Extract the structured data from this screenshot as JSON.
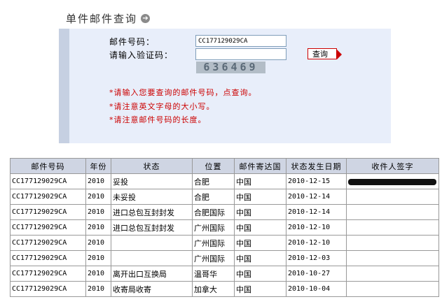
{
  "header": {
    "title": "单件邮件查询"
  },
  "form": {
    "mail_number_label": "邮件号码：",
    "mail_number_value": "CC177129029CA",
    "captcha_label": "请输入验证码：",
    "captcha_value": "",
    "captcha_text": "636469",
    "query_label": "查询"
  },
  "notes": [
    "*请输入您要查询的邮件号码，点查询。",
    "*请注意英文字母的大小写。",
    "*请注意邮件号码的长度。"
  ],
  "table": {
    "headers": [
      "邮件号码",
      "年份",
      "状态",
      "位置",
      "邮件寄达国",
      "状态发生日期",
      "收件人签字"
    ],
    "rows": [
      [
        "CC177129029CA",
        "2010",
        "妥投",
        "合肥",
        "中国",
        "2010-12-15",
        ""
      ],
      [
        "CC177129029CA",
        "2010",
        "未妥投",
        "合肥",
        "中国",
        "2010-12-14",
        ""
      ],
      [
        "CC177129029CA",
        "2010",
        "进口总包互封封发",
        "合肥国际",
        "中国",
        "2010-12-14",
        ""
      ],
      [
        "CC177129029CA",
        "2010",
        "进口总包互封封发",
        "广州国际",
        "中国",
        "2010-12-10",
        ""
      ],
      [
        "CC177129029CA",
        "2010",
        "",
        "广州国际",
        "中国",
        "2010-12-10",
        ""
      ],
      [
        "CC177129029CA",
        "2010",
        "",
        "广州国际",
        "中国",
        "2010-12-03",
        ""
      ],
      [
        "CC177129029CA",
        "2010",
        "离开出口互换局",
        "温哥华",
        "中国",
        "2010-10-27",
        ""
      ],
      [
        "CC177129029CA",
        "2010",
        "收寄局收寄",
        "加拿大",
        "中国",
        "2010-10-04",
        ""
      ]
    ]
  }
}
